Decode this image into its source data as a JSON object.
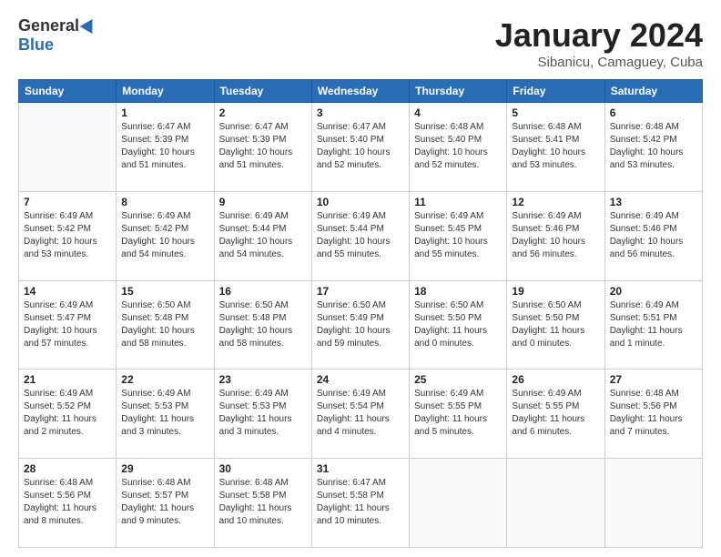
{
  "header": {
    "logo_general": "General",
    "logo_blue": "Blue",
    "title": "January 2024",
    "location": "Sibanicu, Camaguey, Cuba"
  },
  "weekdays": [
    "Sunday",
    "Monday",
    "Tuesday",
    "Wednesday",
    "Thursday",
    "Friday",
    "Saturday"
  ],
  "weeks": [
    [
      {
        "day": "",
        "sunrise": "",
        "sunset": "",
        "daylight": ""
      },
      {
        "day": "1",
        "sunrise": "Sunrise: 6:47 AM",
        "sunset": "Sunset: 5:39 PM",
        "daylight": "Daylight: 10 hours and 51 minutes."
      },
      {
        "day": "2",
        "sunrise": "Sunrise: 6:47 AM",
        "sunset": "Sunset: 5:39 PM",
        "daylight": "Daylight: 10 hours and 51 minutes."
      },
      {
        "day": "3",
        "sunrise": "Sunrise: 6:47 AM",
        "sunset": "Sunset: 5:40 PM",
        "daylight": "Daylight: 10 hours and 52 minutes."
      },
      {
        "day": "4",
        "sunrise": "Sunrise: 6:48 AM",
        "sunset": "Sunset: 5:40 PM",
        "daylight": "Daylight: 10 hours and 52 minutes."
      },
      {
        "day": "5",
        "sunrise": "Sunrise: 6:48 AM",
        "sunset": "Sunset: 5:41 PM",
        "daylight": "Daylight: 10 hours and 53 minutes."
      },
      {
        "day": "6",
        "sunrise": "Sunrise: 6:48 AM",
        "sunset": "Sunset: 5:42 PM",
        "daylight": "Daylight: 10 hours and 53 minutes."
      }
    ],
    [
      {
        "day": "7",
        "sunrise": "Sunrise: 6:49 AM",
        "sunset": "Sunset: 5:42 PM",
        "daylight": "Daylight: 10 hours and 53 minutes."
      },
      {
        "day": "8",
        "sunrise": "Sunrise: 6:49 AM",
        "sunset": "Sunset: 5:42 PM",
        "daylight": "Daylight: 10 hours and 54 minutes."
      },
      {
        "day": "9",
        "sunrise": "Sunrise: 6:49 AM",
        "sunset": "Sunset: 5:44 PM",
        "daylight": "Daylight: 10 hours and 54 minutes."
      },
      {
        "day": "10",
        "sunrise": "Sunrise: 6:49 AM",
        "sunset": "Sunset: 5:44 PM",
        "daylight": "Daylight: 10 hours and 55 minutes."
      },
      {
        "day": "11",
        "sunrise": "Sunrise: 6:49 AM",
        "sunset": "Sunset: 5:45 PM",
        "daylight": "Daylight: 10 hours and 55 minutes."
      },
      {
        "day": "12",
        "sunrise": "Sunrise: 6:49 AM",
        "sunset": "Sunset: 5:46 PM",
        "daylight": "Daylight: 10 hours and 56 minutes."
      },
      {
        "day": "13",
        "sunrise": "Sunrise: 6:49 AM",
        "sunset": "Sunset: 5:46 PM",
        "daylight": "Daylight: 10 hours and 56 minutes."
      }
    ],
    [
      {
        "day": "14",
        "sunrise": "Sunrise: 6:49 AM",
        "sunset": "Sunset: 5:47 PM",
        "daylight": "Daylight: 10 hours and 57 minutes."
      },
      {
        "day": "15",
        "sunrise": "Sunrise: 6:50 AM",
        "sunset": "Sunset: 5:48 PM",
        "daylight": "Daylight: 10 hours and 58 minutes."
      },
      {
        "day": "16",
        "sunrise": "Sunrise: 6:50 AM",
        "sunset": "Sunset: 5:48 PM",
        "daylight": "Daylight: 10 hours and 58 minutes."
      },
      {
        "day": "17",
        "sunrise": "Sunrise: 6:50 AM",
        "sunset": "Sunset: 5:49 PM",
        "daylight": "Daylight: 10 hours and 59 minutes."
      },
      {
        "day": "18",
        "sunrise": "Sunrise: 6:50 AM",
        "sunset": "Sunset: 5:50 PM",
        "daylight": "Daylight: 11 hours and 0 minutes."
      },
      {
        "day": "19",
        "sunrise": "Sunrise: 6:50 AM",
        "sunset": "Sunset: 5:50 PM",
        "daylight": "Daylight: 11 hours and 0 minutes."
      },
      {
        "day": "20",
        "sunrise": "Sunrise: 6:49 AM",
        "sunset": "Sunset: 5:51 PM",
        "daylight": "Daylight: 11 hours and 1 minute."
      }
    ],
    [
      {
        "day": "21",
        "sunrise": "Sunrise: 6:49 AM",
        "sunset": "Sunset: 5:52 PM",
        "daylight": "Daylight: 11 hours and 2 minutes."
      },
      {
        "day": "22",
        "sunrise": "Sunrise: 6:49 AM",
        "sunset": "Sunset: 5:53 PM",
        "daylight": "Daylight: 11 hours and 3 minutes."
      },
      {
        "day": "23",
        "sunrise": "Sunrise: 6:49 AM",
        "sunset": "Sunset: 5:53 PM",
        "daylight": "Daylight: 11 hours and 3 minutes."
      },
      {
        "day": "24",
        "sunrise": "Sunrise: 6:49 AM",
        "sunset": "Sunset: 5:54 PM",
        "daylight": "Daylight: 11 hours and 4 minutes."
      },
      {
        "day": "25",
        "sunrise": "Sunrise: 6:49 AM",
        "sunset": "Sunset: 5:55 PM",
        "daylight": "Daylight: 11 hours and 5 minutes."
      },
      {
        "day": "26",
        "sunrise": "Sunrise: 6:49 AM",
        "sunset": "Sunset: 5:55 PM",
        "daylight": "Daylight: 11 hours and 6 minutes."
      },
      {
        "day": "27",
        "sunrise": "Sunrise: 6:48 AM",
        "sunset": "Sunset: 5:56 PM",
        "daylight": "Daylight: 11 hours and 7 minutes."
      }
    ],
    [
      {
        "day": "28",
        "sunrise": "Sunrise: 6:48 AM",
        "sunset": "Sunset: 5:56 PM",
        "daylight": "Daylight: 11 hours and 8 minutes."
      },
      {
        "day": "29",
        "sunrise": "Sunrise: 6:48 AM",
        "sunset": "Sunset: 5:57 PM",
        "daylight": "Daylight: 11 hours and 9 minutes."
      },
      {
        "day": "30",
        "sunrise": "Sunrise: 6:48 AM",
        "sunset": "Sunset: 5:58 PM",
        "daylight": "Daylight: 11 hours and 10 minutes."
      },
      {
        "day": "31",
        "sunrise": "Sunrise: 6:47 AM",
        "sunset": "Sunset: 5:58 PM",
        "daylight": "Daylight: 11 hours and 10 minutes."
      },
      {
        "day": "",
        "sunrise": "",
        "sunset": "",
        "daylight": ""
      },
      {
        "day": "",
        "sunrise": "",
        "sunset": "",
        "daylight": ""
      },
      {
        "day": "",
        "sunrise": "",
        "sunset": "",
        "daylight": ""
      }
    ]
  ]
}
